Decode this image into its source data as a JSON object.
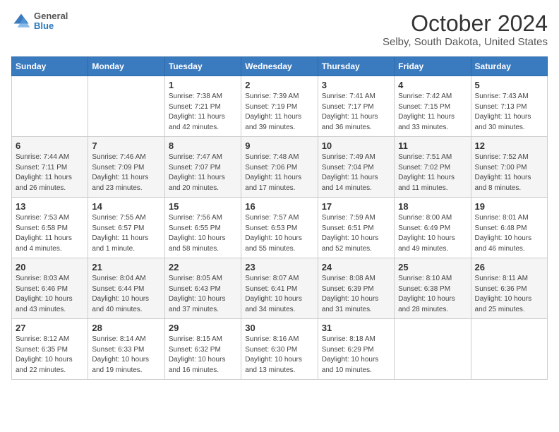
{
  "logo": {
    "line1": "General",
    "line2": "Blue"
  },
  "title": "October 2024",
  "subtitle": "Selby, South Dakota, United States",
  "days_of_week": [
    "Sunday",
    "Monday",
    "Tuesday",
    "Wednesday",
    "Thursday",
    "Friday",
    "Saturday"
  ],
  "weeks": [
    [
      {
        "day": "",
        "sunrise": "",
        "sunset": "",
        "daylight": ""
      },
      {
        "day": "",
        "sunrise": "",
        "sunset": "",
        "daylight": ""
      },
      {
        "day": "1",
        "sunrise": "Sunrise: 7:38 AM",
        "sunset": "Sunset: 7:21 PM",
        "daylight": "Daylight: 11 hours and 42 minutes."
      },
      {
        "day": "2",
        "sunrise": "Sunrise: 7:39 AM",
        "sunset": "Sunset: 7:19 PM",
        "daylight": "Daylight: 11 hours and 39 minutes."
      },
      {
        "day": "3",
        "sunrise": "Sunrise: 7:41 AM",
        "sunset": "Sunset: 7:17 PM",
        "daylight": "Daylight: 11 hours and 36 minutes."
      },
      {
        "day": "4",
        "sunrise": "Sunrise: 7:42 AM",
        "sunset": "Sunset: 7:15 PM",
        "daylight": "Daylight: 11 hours and 33 minutes."
      },
      {
        "day": "5",
        "sunrise": "Sunrise: 7:43 AM",
        "sunset": "Sunset: 7:13 PM",
        "daylight": "Daylight: 11 hours and 30 minutes."
      }
    ],
    [
      {
        "day": "6",
        "sunrise": "Sunrise: 7:44 AM",
        "sunset": "Sunset: 7:11 PM",
        "daylight": "Daylight: 11 hours and 26 minutes."
      },
      {
        "day": "7",
        "sunrise": "Sunrise: 7:46 AM",
        "sunset": "Sunset: 7:09 PM",
        "daylight": "Daylight: 11 hours and 23 minutes."
      },
      {
        "day": "8",
        "sunrise": "Sunrise: 7:47 AM",
        "sunset": "Sunset: 7:07 PM",
        "daylight": "Daylight: 11 hours and 20 minutes."
      },
      {
        "day": "9",
        "sunrise": "Sunrise: 7:48 AM",
        "sunset": "Sunset: 7:06 PM",
        "daylight": "Daylight: 11 hours and 17 minutes."
      },
      {
        "day": "10",
        "sunrise": "Sunrise: 7:49 AM",
        "sunset": "Sunset: 7:04 PM",
        "daylight": "Daylight: 11 hours and 14 minutes."
      },
      {
        "day": "11",
        "sunrise": "Sunrise: 7:51 AM",
        "sunset": "Sunset: 7:02 PM",
        "daylight": "Daylight: 11 hours and 11 minutes."
      },
      {
        "day": "12",
        "sunrise": "Sunrise: 7:52 AM",
        "sunset": "Sunset: 7:00 PM",
        "daylight": "Daylight: 11 hours and 8 minutes."
      }
    ],
    [
      {
        "day": "13",
        "sunrise": "Sunrise: 7:53 AM",
        "sunset": "Sunset: 6:58 PM",
        "daylight": "Daylight: 11 hours and 4 minutes."
      },
      {
        "day": "14",
        "sunrise": "Sunrise: 7:55 AM",
        "sunset": "Sunset: 6:57 PM",
        "daylight": "Daylight: 11 hours and 1 minute."
      },
      {
        "day": "15",
        "sunrise": "Sunrise: 7:56 AM",
        "sunset": "Sunset: 6:55 PM",
        "daylight": "Daylight: 10 hours and 58 minutes."
      },
      {
        "day": "16",
        "sunrise": "Sunrise: 7:57 AM",
        "sunset": "Sunset: 6:53 PM",
        "daylight": "Daylight: 10 hours and 55 minutes."
      },
      {
        "day": "17",
        "sunrise": "Sunrise: 7:59 AM",
        "sunset": "Sunset: 6:51 PM",
        "daylight": "Daylight: 10 hours and 52 minutes."
      },
      {
        "day": "18",
        "sunrise": "Sunrise: 8:00 AM",
        "sunset": "Sunset: 6:49 PM",
        "daylight": "Daylight: 10 hours and 49 minutes."
      },
      {
        "day": "19",
        "sunrise": "Sunrise: 8:01 AM",
        "sunset": "Sunset: 6:48 PM",
        "daylight": "Daylight: 10 hours and 46 minutes."
      }
    ],
    [
      {
        "day": "20",
        "sunrise": "Sunrise: 8:03 AM",
        "sunset": "Sunset: 6:46 PM",
        "daylight": "Daylight: 10 hours and 43 minutes."
      },
      {
        "day": "21",
        "sunrise": "Sunrise: 8:04 AM",
        "sunset": "Sunset: 6:44 PM",
        "daylight": "Daylight: 10 hours and 40 minutes."
      },
      {
        "day": "22",
        "sunrise": "Sunrise: 8:05 AM",
        "sunset": "Sunset: 6:43 PM",
        "daylight": "Daylight: 10 hours and 37 minutes."
      },
      {
        "day": "23",
        "sunrise": "Sunrise: 8:07 AM",
        "sunset": "Sunset: 6:41 PM",
        "daylight": "Daylight: 10 hours and 34 minutes."
      },
      {
        "day": "24",
        "sunrise": "Sunrise: 8:08 AM",
        "sunset": "Sunset: 6:39 PM",
        "daylight": "Daylight: 10 hours and 31 minutes."
      },
      {
        "day": "25",
        "sunrise": "Sunrise: 8:10 AM",
        "sunset": "Sunset: 6:38 PM",
        "daylight": "Daylight: 10 hours and 28 minutes."
      },
      {
        "day": "26",
        "sunrise": "Sunrise: 8:11 AM",
        "sunset": "Sunset: 6:36 PM",
        "daylight": "Daylight: 10 hours and 25 minutes."
      }
    ],
    [
      {
        "day": "27",
        "sunrise": "Sunrise: 8:12 AM",
        "sunset": "Sunset: 6:35 PM",
        "daylight": "Daylight: 10 hours and 22 minutes."
      },
      {
        "day": "28",
        "sunrise": "Sunrise: 8:14 AM",
        "sunset": "Sunset: 6:33 PM",
        "daylight": "Daylight: 10 hours and 19 minutes."
      },
      {
        "day": "29",
        "sunrise": "Sunrise: 8:15 AM",
        "sunset": "Sunset: 6:32 PM",
        "daylight": "Daylight: 10 hours and 16 minutes."
      },
      {
        "day": "30",
        "sunrise": "Sunrise: 8:16 AM",
        "sunset": "Sunset: 6:30 PM",
        "daylight": "Daylight: 10 hours and 13 minutes."
      },
      {
        "day": "31",
        "sunrise": "Sunrise: 8:18 AM",
        "sunset": "Sunset: 6:29 PM",
        "daylight": "Daylight: 10 hours and 10 minutes."
      },
      {
        "day": "",
        "sunrise": "",
        "sunset": "",
        "daylight": ""
      },
      {
        "day": "",
        "sunrise": "",
        "sunset": "",
        "daylight": ""
      }
    ]
  ]
}
